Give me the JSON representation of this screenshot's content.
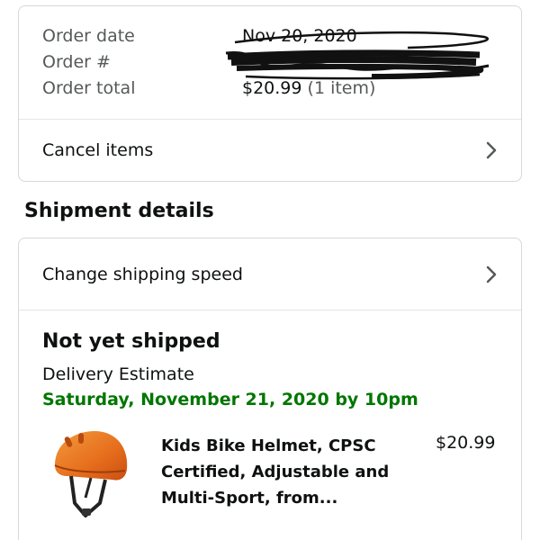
{
  "order_summary": {
    "order_date_label": "Order date",
    "order_date_value": "Nov 20, 2020",
    "order_number_label": "Order #",
    "order_total_label": "Order total",
    "order_total_amount": "$20.99",
    "order_total_items": "(1 item)",
    "cancel_label": "Cancel items"
  },
  "shipment": {
    "section_title": "Shipment details",
    "change_speed_label": "Change shipping speed",
    "status": "Not yet shipped",
    "estimate_label": "Delivery Estimate",
    "estimate_date": "Saturday, November 21, 2020 by 10pm",
    "item": {
      "title": "Kids Bike Helmet, CPSC Certified, Adjustable and Multi-Sport, from...",
      "price": "$20.99",
      "image_icon": "helmet-icon"
    }
  },
  "colors": {
    "delivery_green": "#007600",
    "divider": "#d5d9d9",
    "helmet_orange": "#e8731f"
  }
}
